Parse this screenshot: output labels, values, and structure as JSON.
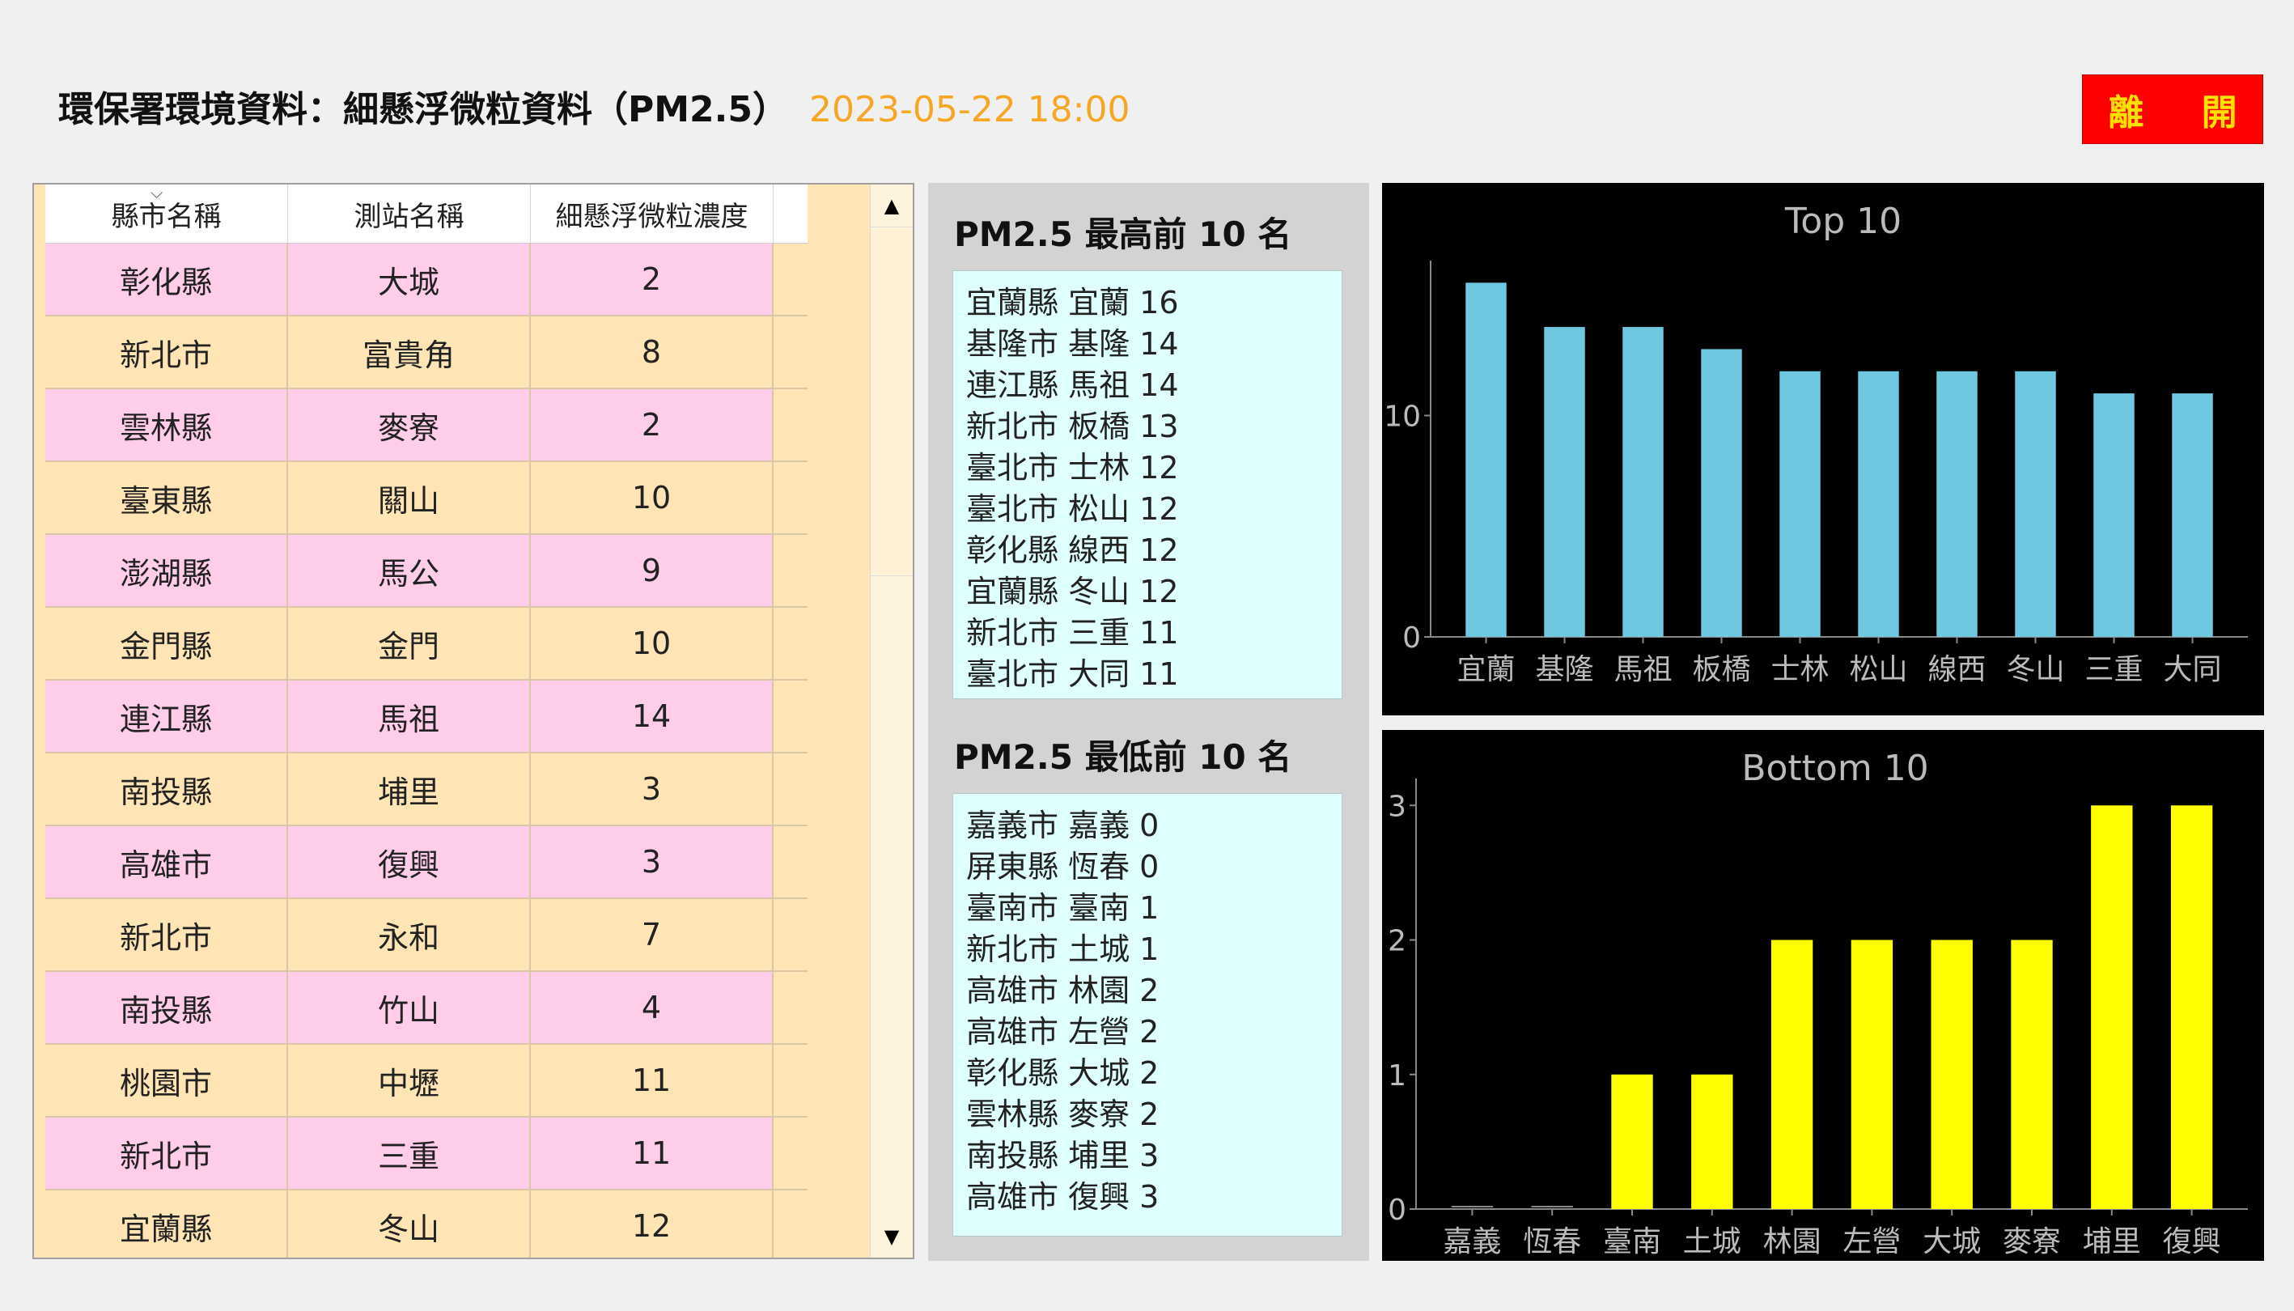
{
  "header": {
    "title": "環保署環境資料：細懸浮微粒資料（PM2.5）",
    "datetime": "2023-05-22 18:00",
    "exit_label": "離 開"
  },
  "table": {
    "columns": [
      "縣市名稱",
      "測站名稱",
      "細懸浮微粒濃度"
    ],
    "rows": [
      [
        "彰化縣",
        "大城",
        "2"
      ],
      [
        "新北市",
        "富貴角",
        "8"
      ],
      [
        "雲林縣",
        "麥寮",
        "2"
      ],
      [
        "臺東縣",
        "關山",
        "10"
      ],
      [
        "澎湖縣",
        "馬公",
        "9"
      ],
      [
        "金門縣",
        "金門",
        "10"
      ],
      [
        "連江縣",
        "馬祖",
        "14"
      ],
      [
        "南投縣",
        "埔里",
        "3"
      ],
      [
        "高雄市",
        "復興",
        "3"
      ],
      [
        "新北市",
        "永和",
        "7"
      ],
      [
        "南投縣",
        "竹山",
        "4"
      ],
      [
        "桃園市",
        "中壢",
        "11"
      ],
      [
        "新北市",
        "三重",
        "11"
      ],
      [
        "宜蘭縣",
        "冬山",
        "12"
      ]
    ]
  },
  "top_list": {
    "heading": "PM2.5 最高前 10 名",
    "items": [
      "宜蘭縣 宜蘭 16",
      "基隆市 基隆 14",
      "連江縣 馬祖 14",
      "新北市 板橋 13",
      "臺北市 士林 12",
      "臺北市 松山 12",
      "彰化縣 線西 12",
      "宜蘭縣 冬山 12",
      "新北市 三重 11",
      "臺北市 大同 11"
    ]
  },
  "bottom_list": {
    "heading": "PM2.5 最低前 10 名",
    "items": [
      "嘉義市 嘉義 0",
      "屏東縣 恆春 0",
      "臺南市 臺南 1",
      "新北市 土城 1",
      "高雄市 林園 2",
      "高雄市 左營 2",
      "彰化縣 大城 2",
      "雲林縣 麥寮 2",
      "南投縣 埔里 3",
      "高雄市 復興 3"
    ]
  },
  "colors": {
    "top_bar": "#6ec8e0",
    "bottom_bar": "#ffff00",
    "axis": "#888888",
    "chart_text": "#bbbbbb"
  },
  "chart_data": [
    {
      "type": "bar",
      "title": "Top 10",
      "categories": [
        "宜蘭",
        "基隆",
        "馬祖",
        "板橋",
        "士林",
        "松山",
        "線西",
        "冬山",
        "三重",
        "大同"
      ],
      "values": [
        16,
        14,
        14,
        13,
        12,
        12,
        12,
        12,
        11,
        11
      ],
      "yticks": [
        0,
        10
      ],
      "ylim": [
        0,
        17
      ],
      "grid": false
    },
    {
      "type": "bar",
      "title": "Bottom 10",
      "categories": [
        "嘉義",
        "恆春",
        "臺南",
        "土城",
        "林園",
        "左營",
        "大城",
        "麥寮",
        "埔里",
        "復興"
      ],
      "values": [
        0,
        0,
        1,
        1,
        2,
        2,
        2,
        2,
        3,
        3
      ],
      "yticks": [
        0,
        1,
        2,
        3
      ],
      "ylim": [
        0,
        3.2
      ],
      "grid": false
    }
  ]
}
